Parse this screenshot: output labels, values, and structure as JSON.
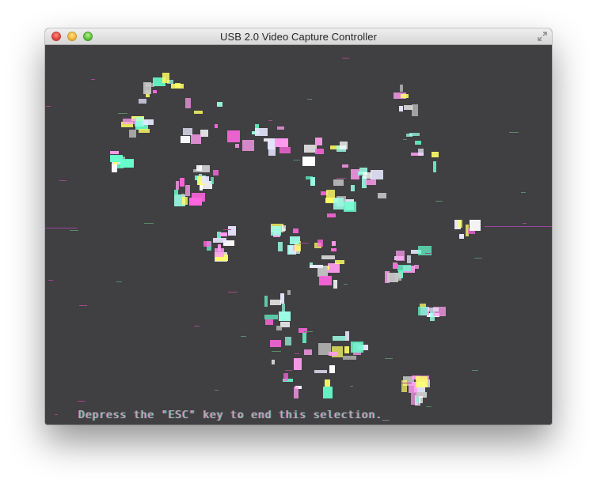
{
  "window": {
    "title": "USB 2.0 Video Capture Controller"
  },
  "controls": {
    "close": "close-button",
    "minimize": "minimize-button",
    "zoom": "zoom-button",
    "fullscreen_icon": "fullscreen-icon"
  },
  "screen": {
    "prompt_text": "Depress the \"ESC\" key to end this selection._"
  },
  "colors": {
    "screen_bg": "#403f41",
    "glitch": [
      "#ff9cf0",
      "#ffff66",
      "#9cffe8",
      "#ffffff",
      "#c8c8c8",
      "#ff66e0",
      "#66ffcc",
      "#e8e8ff"
    ]
  }
}
